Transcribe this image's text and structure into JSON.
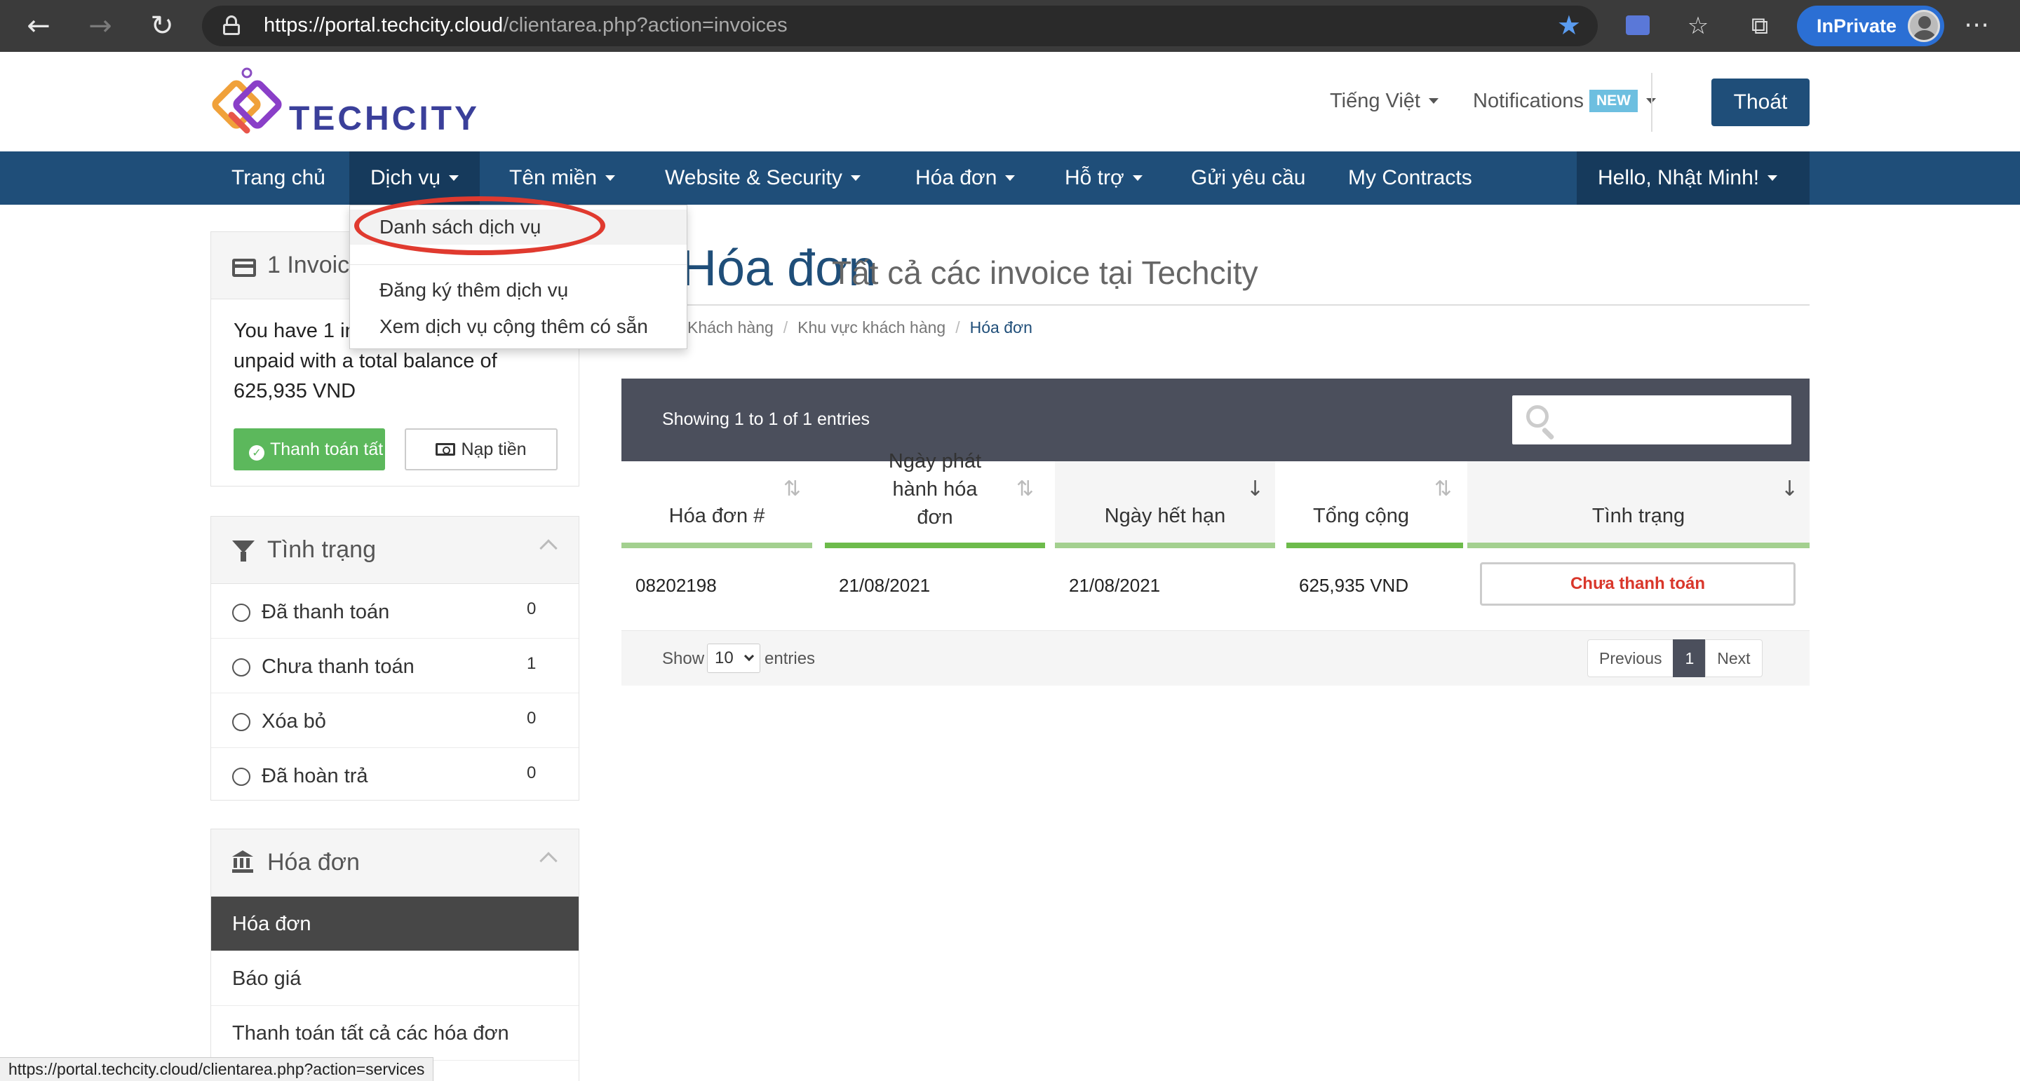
{
  "browser": {
    "url_host": "https://portal.techcity.cloud",
    "url_path": "/clientarea.php?action=invoices",
    "inprivate_label": "InPrivate",
    "status_url": "https://portal.techcity.cloud/clientarea.php?action=services"
  },
  "header": {
    "logo_text": "TECHCITY",
    "language": "Tiếng Việt",
    "notifications": "Notifications",
    "notifications_badge": "NEW",
    "logout": "Thoát"
  },
  "nav": {
    "items": [
      "Trang chủ",
      "Dịch vụ",
      "Tên miền",
      "Website & Security",
      "Hóa đơn",
      "Hỗ trợ",
      "Gửi yêu cầu",
      "My Contracts"
    ],
    "hello": "Hello, Nhật Minh!"
  },
  "dropdown": {
    "items": [
      "Danh sách dịch vụ",
      "Đăng ký thêm dịch vụ",
      "Xem dịch vụ cộng thêm có sẵn"
    ]
  },
  "sidebar": {
    "invoice_panel": {
      "title": "1 Invoice",
      "text": "You have 1 invoice(s) currently unpaid with a total balance of 625,935 VND",
      "pay_all": "Thanh toán tất cả",
      "deposit": "Nạp tiền"
    },
    "status_panel": {
      "title": "Tình trạng",
      "items": [
        {
          "label": "Đã thanh toán",
          "count": "0"
        },
        {
          "label": "Chưa thanh toán",
          "count": "1"
        },
        {
          "label": "Xóa bỏ",
          "count": "0"
        },
        {
          "label": "Đã hoàn trả",
          "count": "0"
        }
      ]
    },
    "billing_panel": {
      "title": "Hóa đơn",
      "items": [
        "Hóa đơn",
        "Báo giá",
        "Thanh toán tất cả các hóa đơn"
      ]
    }
  },
  "content": {
    "title": "Hóa đơn",
    "subtitle": "Tất cả các invoice tại Techcity",
    "breadcrumb": [
      "Khách hàng",
      "Khu vực khách hàng",
      "Hóa đơn"
    ],
    "showing": "Showing 1 to 1 of 1 entries",
    "search_placeholder": "",
    "columns": [
      "Hóa đơn #",
      "Ngày phát hành hóa đơn",
      "Ngày hết hạn",
      "Tổng cộng",
      "Tình trạng"
    ],
    "rows": [
      {
        "invoice": "08202198",
        "issued": "21/08/2021",
        "due": "21/08/2021",
        "total": "625,935 VND",
        "status": "Chưa thanh toán"
      }
    ],
    "show_label": "Show",
    "page_length": "10",
    "entries_label": "entries",
    "pager": {
      "previous": "Previous",
      "current": "1",
      "next": "Next"
    }
  },
  "colors": {
    "nav_blue": "#1f4e79",
    "dark_panel": "#4b4f5c",
    "pay_green": "#5cb85c",
    "unpaid_red": "#d9372b",
    "highlight_ring": "#e03a2f"
  }
}
